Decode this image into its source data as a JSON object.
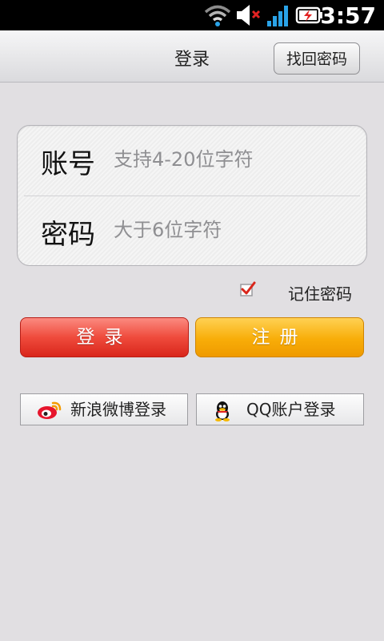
{
  "status_bar": {
    "time": "3:57",
    "icons": [
      "wifi-icon",
      "volume-muted-icon",
      "signal-icon",
      "battery-charging-icon"
    ]
  },
  "header": {
    "title": "登录",
    "forgot_label": "找回密码"
  },
  "form": {
    "account_label": "账号",
    "account_placeholder": "支持4-20位字符",
    "password_label": "密码",
    "password_placeholder": "大于6位字符",
    "remember_label": "记住密码",
    "remember_checked": true
  },
  "actions": {
    "login_label": "登录",
    "register_label": "注册"
  },
  "social": {
    "weibo_label": "新浪微博登录",
    "qq_label": "QQ账户登录"
  },
  "colors": {
    "login_red": "#ef4b3c",
    "register_orange": "#f8ad08",
    "checkbox_red": "#d9261b"
  }
}
